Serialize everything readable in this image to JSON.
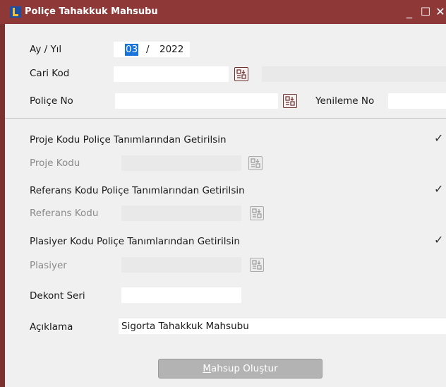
{
  "window": {
    "title": "Poliçe Tahakkuk Mahsubu",
    "minimize_glyph": "_",
    "maximize_glyph": "☐",
    "close_glyph": "✕"
  },
  "form": {
    "period": {
      "label": "Ay / Yıl",
      "month": "03",
      "separator": "/",
      "year": "2022"
    },
    "cari_kod": {
      "label": "Cari Kod",
      "value": "",
      "description": ""
    },
    "police_no": {
      "label": "Poliçe No",
      "value": ""
    },
    "yenileme_no": {
      "label": "Yenileme No",
      "value": ""
    },
    "proje_option": {
      "label": "Proje Kodu Poliçe Tanımlarından Getirilsin",
      "checked": true,
      "check_glyph": "✓"
    },
    "proje_kodu": {
      "label": "Proje Kodu",
      "value": "",
      "enabled": false
    },
    "referans_option": {
      "label": "Referans Kodu Poliçe Tanımlarından Getirilsin",
      "checked": true,
      "check_glyph": "✓"
    },
    "referans_kodu": {
      "label": "Referans Kodu",
      "value": "",
      "enabled": false
    },
    "plasiyer_option": {
      "label": "Plasiyer Kodu Poliçe Tanımlarından Getirilsin",
      "checked": true,
      "check_glyph": "✓"
    },
    "plasiyer": {
      "label": "Plasiyer",
      "value": "",
      "enabled": false
    },
    "dekont_seri": {
      "label": "Dekont Seri",
      "value": ""
    },
    "aciklama": {
      "label": "Açıklama",
      "value": "Sigorta Tahakkuk Mahsubu"
    }
  },
  "actions": {
    "mahsup": {
      "mnemonic": "M",
      "rest": "ahsup Oluştur"
    }
  },
  "icons": {
    "app": "app-logo-icon",
    "lookup": "lookup-list-icon"
  },
  "colors": {
    "titlebar": "#8e3838",
    "selection": "#1a73d9",
    "button_disabled": "#b3b3b3"
  }
}
